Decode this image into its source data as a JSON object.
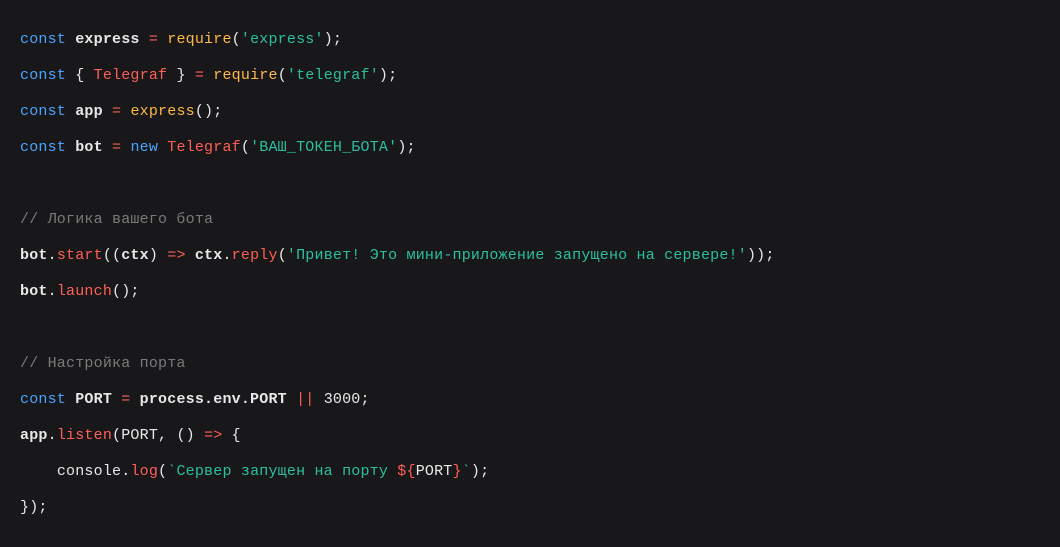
{
  "code": {
    "l1": {
      "kw": "const",
      "id": "express",
      "eq": "=",
      "call": "require",
      "p1": "(",
      "str": "'express'",
      "p2": ");"
    },
    "l2": {
      "kw": "const",
      "p1": "{ ",
      "cls": "Telegraf",
      "p2": " } ",
      "eq": "=",
      "call": "require",
      "p3": "(",
      "str": "'telegraf'",
      "p4": ");"
    },
    "l3": {
      "kw": "const",
      "id": "app",
      "eq": "=",
      "call": "express",
      "p1": "();"
    },
    "l4": {
      "kw": "const",
      "id": "bot",
      "eq": "=",
      "new": "new",
      "cls": "Telegraf",
      "p1": "(",
      "str": "'ВАШ_ТОКЕН_БОТА'",
      "p2": ");"
    },
    "l6": {
      "cmt": "// Логика вашего бота"
    },
    "l7": {
      "obj": "bot",
      "dot1": ".",
      "m1": "start",
      "p1": "((",
      "arg": "ctx",
      "p2": ") ",
      "arrow": "=>",
      "obj2": " ctx",
      "dot2": ".",
      "m2": "reply",
      "p3": "(",
      "str": "'Привет! Это мини-приложение запущено на сервере!'",
      "p4": "));"
    },
    "l8": {
      "obj": "bot",
      "dot": ".",
      "m": "launch",
      "p": "();"
    },
    "l10": {
      "cmt": "// Настройка порта"
    },
    "l11": {
      "kw": "const",
      "id": "PORT",
      "eq": "=",
      "expr": " process.env.PORT ",
      "or": "||",
      "sp": " ",
      "num": "3000",
      "p": ";"
    },
    "l12": {
      "obj": "app",
      "dot": ".",
      "m": "listen",
      "p1": "(",
      "arg": "PORT",
      "p2": ", () ",
      "arrow": "=>",
      "p3": " {"
    },
    "l13": {
      "indent": "    ",
      "obj": "console",
      "dot": ".",
      "m": "log",
      "p1": "(",
      "bt1": "`",
      "txt": "Сервер запущен на порту ",
      "il1": "${",
      "var": "PORT",
      "il2": "}",
      "bt2": "`",
      "p2": ");"
    },
    "l14": {
      "p": "});"
    }
  }
}
